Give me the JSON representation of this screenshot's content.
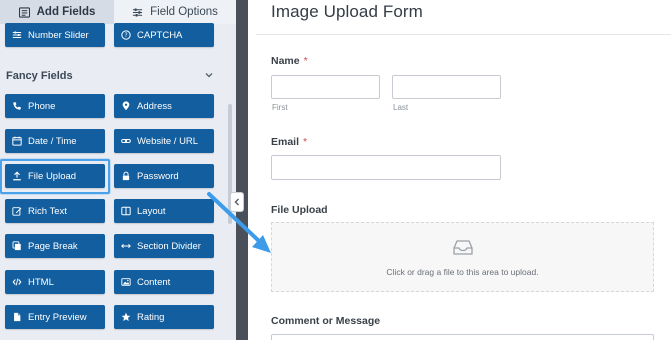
{
  "tabs": {
    "add_fields": "Add Fields",
    "field_options": "Field Options"
  },
  "fancy_fields_title": "Fancy Fields",
  "buttons": {
    "number_slider": "Number Slider",
    "captcha": "CAPTCHA",
    "phone": "Phone",
    "address": "Address",
    "date_time": "Date / Time",
    "website_url": "Website / URL",
    "file_upload": "File Upload",
    "password": "Password",
    "rich_text": "Rich Text",
    "layout": "Layout",
    "page_break": "Page Break",
    "section_divider": "Section Divider",
    "html": "HTML",
    "content": "Content",
    "entry_preview": "Entry Preview",
    "rating": "Rating"
  },
  "form": {
    "title": "Image Upload Form",
    "name_label": "Name",
    "required_mark": "*",
    "first_sub": "First",
    "last_sub": "Last",
    "email_label": "Email",
    "file_upload_label": "File Upload",
    "upload_hint": "Click or drag a file to this area to upload.",
    "comment_label": "Comment or Message"
  },
  "colors": {
    "button_blue": "#135e9e",
    "highlight_blue": "#4aa3ea",
    "arrow_blue": "#3d9be9",
    "panel_bg": "#e9edf3",
    "required_red": "#d04b4b"
  },
  "icons": {
    "add_fields": "list-icon",
    "field_options": "sliders-icon",
    "number_slider": "sliders-icon",
    "captcha": "question-circle-icon",
    "phone": "phone-icon",
    "address": "map-pin-icon",
    "date_time": "calendar-icon",
    "website_url": "link-icon",
    "file_upload": "upload-icon",
    "password": "lock-icon",
    "rich_text": "edit-icon",
    "layout": "columns-icon",
    "page_break": "copy-icon",
    "section_divider": "arrows-h-icon",
    "html": "code-icon",
    "content": "image-icon",
    "entry_preview": "file-icon",
    "rating": "star-icon",
    "upload_zone": "inbox-icon"
  }
}
